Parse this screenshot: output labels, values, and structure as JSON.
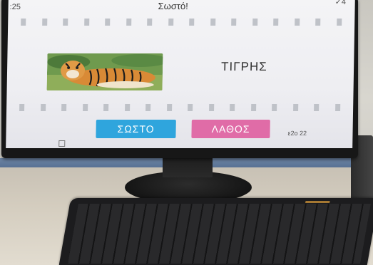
{
  "screen": {
    "top_left_count": ":25",
    "feedback_title": "Σωστό!",
    "check_count": "✓4",
    "word": "ΤΙΓΡΗΣ",
    "correct_button_label": "ΣΩΣΤΟ",
    "wrong_button_label": "ΛΑΘΟΣ",
    "bottom_counter": "ε2ο  22"
  },
  "image_subject": "tiger-photo",
  "colors": {
    "correct_button": "#2fa5dd",
    "wrong_button": "#e06ca7",
    "screen_bg": "#f1f1f4"
  }
}
